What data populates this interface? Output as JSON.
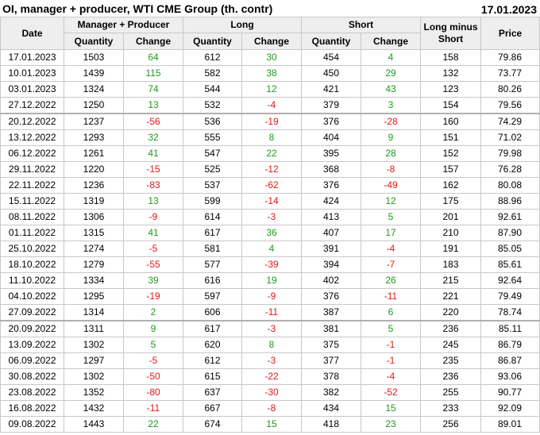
{
  "header": {
    "title": "OI, manager + producer, WTI CME Group (th. contr)",
    "date": "17.01.2023"
  },
  "columns": {
    "date": "Date",
    "group1": "Manager + Producer",
    "group2": "Long",
    "group3": "Short",
    "long_minus_short": "Long minus Short",
    "price": "Price",
    "quantity": "Quantity",
    "change": "Change"
  },
  "colors": {
    "positive": "#1e9a1e",
    "negative": "#e01818",
    "header_bg": "#eeeeee",
    "border": "#c8c8c8"
  },
  "rows": [
    {
      "date": "17.01.2023",
      "mp_qty": "1503",
      "mp_chg": "64",
      "long_qty": "612",
      "long_chg": "30",
      "short_qty": "454",
      "short_chg": "4",
      "lms": "158",
      "price": "79.86"
    },
    {
      "date": "10.01.2023",
      "mp_qty": "1439",
      "mp_chg": "115",
      "long_qty": "582",
      "long_chg": "38",
      "short_qty": "450",
      "short_chg": "29",
      "lms": "132",
      "price": "73.77"
    },
    {
      "date": "03.01.2023",
      "mp_qty": "1324",
      "mp_chg": "74",
      "long_qty": "544",
      "long_chg": "12",
      "short_qty": "421",
      "short_chg": "43",
      "lms": "123",
      "price": "80.26"
    },
    {
      "date": "27.12.2022",
      "mp_qty": "1250",
      "mp_chg": "13",
      "long_qty": "532",
      "long_chg": "-4",
      "short_qty": "379",
      "short_chg": "3",
      "lms": "154",
      "price": "79.56"
    },
    {
      "date": "20.12.2022",
      "mp_qty": "1237",
      "mp_chg": "-56",
      "long_qty": "536",
      "long_chg": "-19",
      "short_qty": "376",
      "short_chg": "-28",
      "lms": "160",
      "price": "74.29"
    },
    {
      "date": "13.12.2022",
      "mp_qty": "1293",
      "mp_chg": "32",
      "long_qty": "555",
      "long_chg": "8",
      "short_qty": "404",
      "short_chg": "9",
      "lms": "151",
      "price": "71.02"
    },
    {
      "date": "06.12.2022",
      "mp_qty": "1261",
      "mp_chg": "41",
      "long_qty": "547",
      "long_chg": "22",
      "short_qty": "395",
      "short_chg": "28",
      "lms": "152",
      "price": "79.98"
    },
    {
      "date": "29.11.2022",
      "mp_qty": "1220",
      "mp_chg": "-15",
      "long_qty": "525",
      "long_chg": "-12",
      "short_qty": "368",
      "short_chg": "-8",
      "lms": "157",
      "price": "76.28"
    },
    {
      "date": "22.11.2022",
      "mp_qty": "1236",
      "mp_chg": "-83",
      "long_qty": "537",
      "long_chg": "-62",
      "short_qty": "376",
      "short_chg": "-49",
      "lms": "162",
      "price": "80.08"
    },
    {
      "date": "15.11.2022",
      "mp_qty": "1319",
      "mp_chg": "13",
      "long_qty": "599",
      "long_chg": "-14",
      "short_qty": "424",
      "short_chg": "12",
      "lms": "175",
      "price": "88.96"
    },
    {
      "date": "08.11.2022",
      "mp_qty": "1306",
      "mp_chg": "-9",
      "long_qty": "614",
      "long_chg": "-3",
      "short_qty": "413",
      "short_chg": "5",
      "lms": "201",
      "price": "92.61"
    },
    {
      "date": "01.11.2022",
      "mp_qty": "1315",
      "mp_chg": "41",
      "long_qty": "617",
      "long_chg": "36",
      "short_qty": "407",
      "short_chg": "17",
      "lms": "210",
      "price": "87.90"
    },
    {
      "date": "25.10.2022",
      "mp_qty": "1274",
      "mp_chg": "-5",
      "long_qty": "581",
      "long_chg": "4",
      "short_qty": "391",
      "short_chg": "-4",
      "lms": "191",
      "price": "85.05"
    },
    {
      "date": "18.10.2022",
      "mp_qty": "1279",
      "mp_chg": "-55",
      "long_qty": "577",
      "long_chg": "-39",
      "short_qty": "394",
      "short_chg": "-7",
      "lms": "183",
      "price": "85.61"
    },
    {
      "date": "11.10.2022",
      "mp_qty": "1334",
      "mp_chg": "39",
      "long_qty": "616",
      "long_chg": "19",
      "short_qty": "402",
      "short_chg": "26",
      "lms": "215",
      "price": "92.64"
    },
    {
      "date": "04.10.2022",
      "mp_qty": "1295",
      "mp_chg": "-19",
      "long_qty": "597",
      "long_chg": "-9",
      "short_qty": "376",
      "short_chg": "-11",
      "lms": "221",
      "price": "79.49"
    },
    {
      "date": "27.09.2022",
      "mp_qty": "1314",
      "mp_chg": "2",
      "long_qty": "606",
      "long_chg": "-11",
      "short_qty": "387",
      "short_chg": "6",
      "lms": "220",
      "price": "78.74"
    },
    {
      "date": "20.09.2022",
      "mp_qty": "1311",
      "mp_chg": "9",
      "long_qty": "617",
      "long_chg": "-3",
      "short_qty": "381",
      "short_chg": "5",
      "lms": "236",
      "price": "85.11"
    },
    {
      "date": "13.09.2022",
      "mp_qty": "1302",
      "mp_chg": "5",
      "long_qty": "620",
      "long_chg": "8",
      "short_qty": "375",
      "short_chg": "-1",
      "lms": "245",
      "price": "86.79"
    },
    {
      "date": "06.09.2022",
      "mp_qty": "1297",
      "mp_chg": "-5",
      "long_qty": "612",
      "long_chg": "-3",
      "short_qty": "377",
      "short_chg": "-1",
      "lms": "235",
      "price": "86.87"
    },
    {
      "date": "30.08.2022",
      "mp_qty": "1302",
      "mp_chg": "-50",
      "long_qty": "615",
      "long_chg": "-22",
      "short_qty": "378",
      "short_chg": "-4",
      "lms": "236",
      "price": "93.06"
    },
    {
      "date": "23.08.2022",
      "mp_qty": "1352",
      "mp_chg": "-80",
      "long_qty": "637",
      "long_chg": "-30",
      "short_qty": "382",
      "short_chg": "-52",
      "lms": "255",
      "price": "90.77"
    },
    {
      "date": "16.08.2022",
      "mp_qty": "1432",
      "mp_chg": "-11",
      "long_qty": "667",
      "long_chg": "-8",
      "short_qty": "434",
      "short_chg": "15",
      "lms": "233",
      "price": "92.09"
    },
    {
      "date": "09.08.2022",
      "mp_qty": "1443",
      "mp_chg": "22",
      "long_qty": "674",
      "long_chg": "15",
      "short_qty": "418",
      "short_chg": "23",
      "lms": "256",
      "price": "89.01"
    }
  ]
}
